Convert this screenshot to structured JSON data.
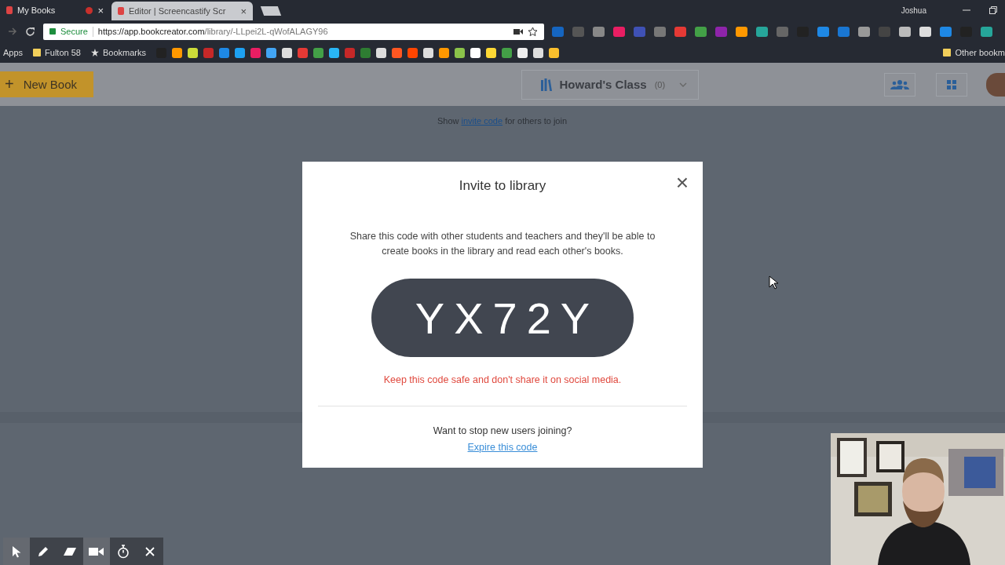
{
  "browser": {
    "tabs": [
      {
        "title": "My Books",
        "selected": true,
        "recording": true,
        "close": "×"
      },
      {
        "title": "Editor | Screencastify Scr",
        "selected": false,
        "recording": false,
        "close": "×"
      }
    ],
    "profile": "Joshua",
    "address": {
      "secure_label": "Secure",
      "host": "https://app.bookcreator.com",
      "path": "/library/-LLpei2L-qWofALAGY96"
    },
    "bookmarks": [
      {
        "label": "Apps",
        "kind": "apps"
      },
      {
        "label": "Fulton 58",
        "kind": "folder"
      },
      {
        "label": "Bookmarks",
        "kind": "star"
      }
    ],
    "other_bookmarks": "Other bookm"
  },
  "header": {
    "new_book": {
      "icon": "+",
      "label": "New Book"
    },
    "library": {
      "name": "Howard's Class",
      "count": "(0)"
    }
  },
  "invite_hint": {
    "before": "Show",
    "link": "invite code",
    "after": "for others to join"
  },
  "modal": {
    "title": "Invite to library",
    "close": "×",
    "body": "Share this code with other students and teachers and they'll be able to create books in the library and read each other's books.",
    "code": "YX72Y",
    "warning": "Keep this code safe and don't share it on social media.",
    "question": "Want to stop new users joining?",
    "link": "Expire this code"
  },
  "recorder_toolbar": [
    {
      "kind": "pointer",
      "selected": true
    },
    {
      "kind": "pen",
      "selected": false
    },
    {
      "kind": "eraser",
      "selected": false
    },
    {
      "kind": "camera",
      "selected": true
    },
    {
      "kind": "timer",
      "selected": false
    },
    {
      "kind": "close",
      "selected": false
    }
  ]
}
